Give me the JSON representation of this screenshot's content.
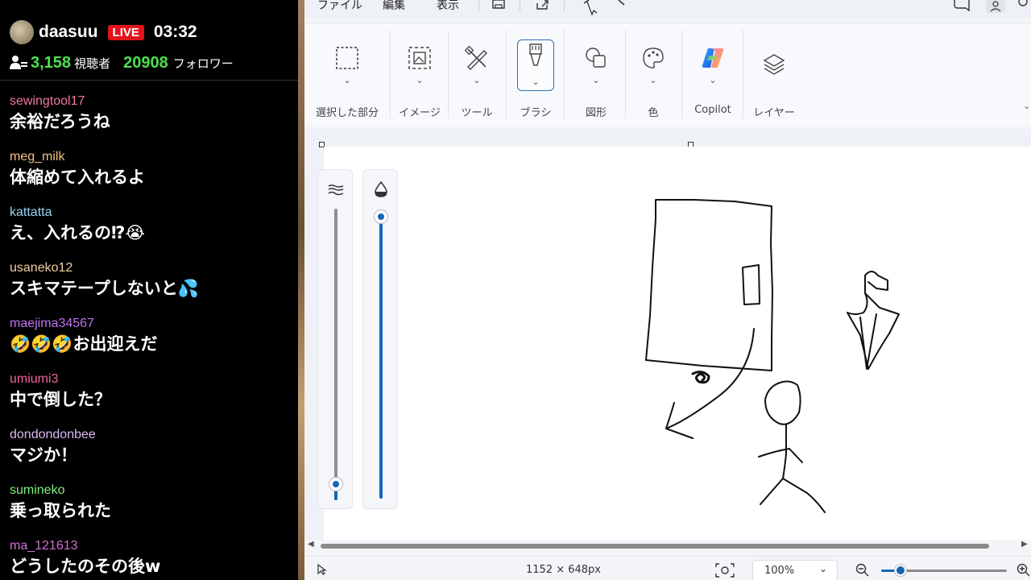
{
  "stream": {
    "streamer": "daasuu",
    "live_label": "LIVE",
    "uptime": "03:32",
    "viewers": "3,158",
    "viewers_label": "視聴者",
    "followers": "20908",
    "followers_label": "フォロワー"
  },
  "chat": {
    "messages": [
      {
        "user": "sewingtool17",
        "user_color": "#f07aa0",
        "text": "余裕だろうね"
      },
      {
        "user": "meg_milk",
        "user_color": "#f0c080",
        "text": "体縮めて入れるよ"
      },
      {
        "user": "kattatta",
        "user_color": "#9ad4f0",
        "text": "え、入れるの⁉😭"
      },
      {
        "user": "usaneko12",
        "user_color": "#f0d0a0",
        "text": "スキマテープしないと💦"
      },
      {
        "user": "maejima34567",
        "user_color": "#c070f0",
        "text": "🤣🤣🤣お出迎えだ"
      },
      {
        "user": "umiumi3",
        "user_color": "#f0609a",
        "text": "中で倒した？"
      },
      {
        "user": "dondondonbee",
        "user_color": "#d8b8f0",
        "text": "マジか！"
      },
      {
        "user": "sumineko",
        "user_color": "#80f080",
        "text": "乗っ取られた"
      },
      {
        "user": "ma_121613",
        "user_color": "#d070d0",
        "text": "どうしたのその後w"
      }
    ]
  },
  "paint": {
    "menu": {
      "file": "ファイル",
      "edit": "編集",
      "view": "表示"
    },
    "ribbon": {
      "selection": "選択した部分",
      "image": "イメージ",
      "tools": "ツール",
      "brush": "ブラシ",
      "shapes": "図形",
      "color": "色",
      "copilot": "Copilot",
      "layers": "レイヤー"
    },
    "status": {
      "dimensions": "1152 × 648px",
      "zoom": "100%"
    },
    "sliders": {
      "size_level": 0.02,
      "opacity_level": 1.0
    },
    "colors": {
      "accent": "#1366b8",
      "live_red": "#e4121a",
      "count_green": "#4ee04e"
    }
  }
}
